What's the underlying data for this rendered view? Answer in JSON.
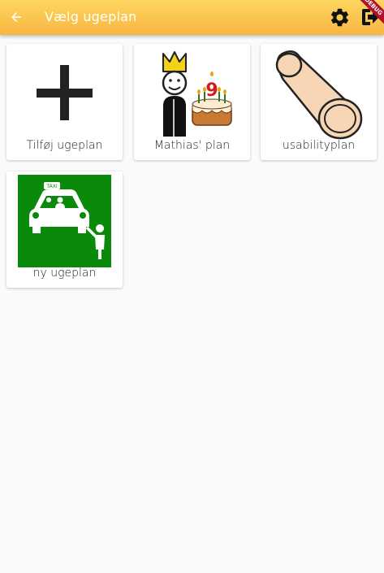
{
  "appbar": {
    "title": "Vælg ugeplan",
    "back_icon": "arrow-left-icon",
    "settings_icon": "gear-icon",
    "logout_icon": "logout-icon",
    "debug_banner": "DEBUG"
  },
  "colors": {
    "appbar_top": "#fdd65f",
    "appbar_bottom": "#f8b641",
    "background": "#fafafa",
    "taxi_green": "#0a8a0a"
  },
  "cards": [
    {
      "label": "Tilføj ugeplan",
      "icon": "plus-icon"
    },
    {
      "label": "Mathias' plan",
      "icon": "king-birthday-cake-pictogram"
    },
    {
      "label": "usabilityplan",
      "icon": "log-pictogram"
    },
    {
      "label": "ny ugeplan",
      "icon": "taxi-pictogram",
      "image_text": "TAXI"
    }
  ]
}
